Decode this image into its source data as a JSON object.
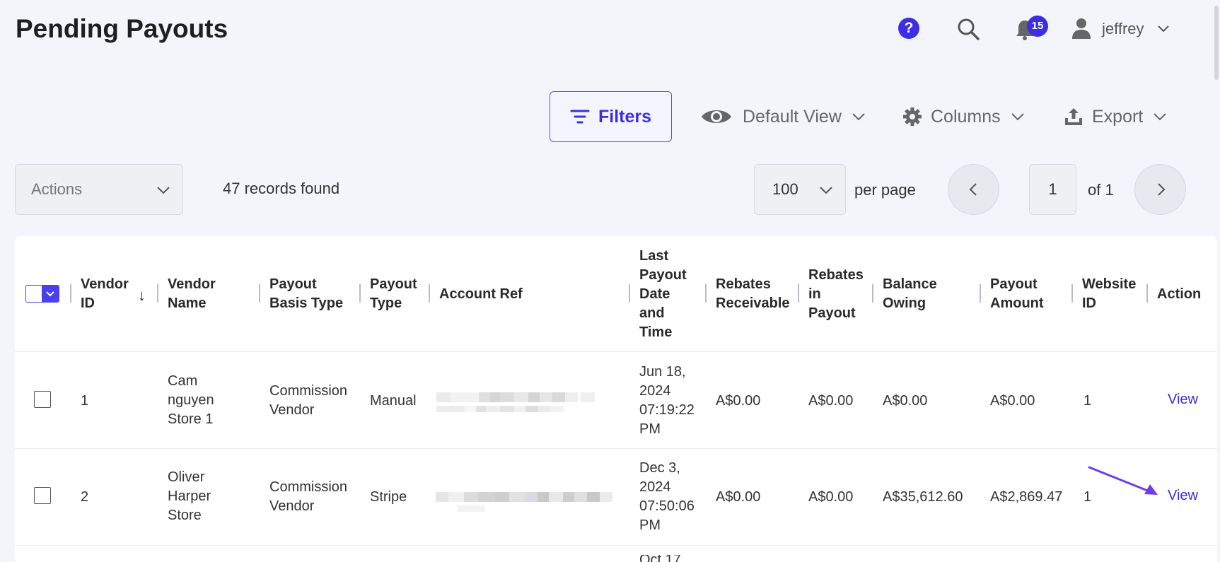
{
  "page": {
    "title": "Pending Payouts"
  },
  "header": {
    "help_glyph": "?",
    "notification_count": "15",
    "user_name": "jeffrey"
  },
  "toolbar": {
    "filters_label": "Filters",
    "view_label": "Default View",
    "columns_label": "Columns",
    "export_label": "Export"
  },
  "list_controls": {
    "actions_placeholder": "Actions",
    "records_found": "47 records found",
    "per_page_value": "100",
    "per_page_label": "per page",
    "current_page": "1",
    "page_of": "of 1"
  },
  "table": {
    "columns": [
      "Vendor ID",
      "Vendor Name",
      "Payout Basis Type",
      "Payout Type",
      "Account Ref",
      "Last Payout Date and Time",
      "Rebates Receivable",
      "Rebates in Payout",
      "Balance Owing",
      "Payout Amount",
      "Website ID",
      "Action"
    ],
    "sort_indicator": "↓",
    "rows": [
      {
        "vendor_id": "1",
        "vendor_name": "Cam nguyen Store 1",
        "payout_basis_type": "Commission Vendor",
        "payout_type": "Manual",
        "last_payout": "Jun 18, 2024 07:19:22 PM",
        "rebates_receivable": "A$0.00",
        "rebates_in_payout": "A$0.00",
        "balance_owing": "A$0.00",
        "payout_amount": "A$0.00",
        "website_id": "1",
        "action": "View"
      },
      {
        "vendor_id": "2",
        "vendor_name": "Oliver Harper Store",
        "payout_basis_type": "Commission Vendor",
        "payout_type": "Stripe",
        "last_payout": "Dec 3, 2024 07:50:06 PM",
        "rebates_receivable": "A$0.00",
        "rebates_in_payout": "A$0.00",
        "balance_owing": "A$35,612.60",
        "payout_amount": "A$2,869.47",
        "website_id": "1",
        "action": "View"
      }
    ],
    "partial_row_text": "Oct 17"
  },
  "colors": {
    "accent": "#3d2ee6",
    "background": "#f4f5fb",
    "annotation_arrow": "#6a3df0"
  }
}
